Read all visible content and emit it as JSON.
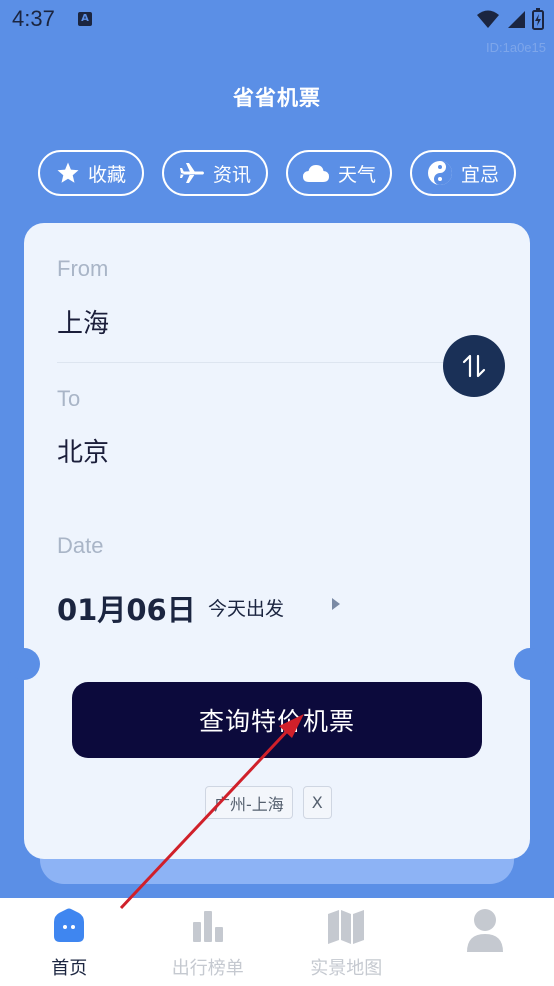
{
  "status_bar": {
    "time": "4:37",
    "notification_badge": "A"
  },
  "watermark": "ID:1a0e15",
  "app_title": "省省机票",
  "chips": [
    {
      "icon": "star-icon",
      "label": "收藏"
    },
    {
      "icon": "plane-icon",
      "label": "资讯"
    },
    {
      "icon": "cloud-icon",
      "label": "天气"
    },
    {
      "icon": "yin-yang-icon",
      "label": "宜忌"
    }
  ],
  "form": {
    "from_label": "From",
    "from_city": "上海",
    "to_label": "To",
    "to_city": "北京",
    "date_label": "Date",
    "date_value": "01月06日",
    "date_note": "今天出发"
  },
  "search_button": "查询特价机票",
  "history": {
    "item": "广州-上海",
    "clear": "X"
  },
  "tabs": [
    {
      "label": "首页",
      "icon": "home-icon",
      "active": true
    },
    {
      "label": "出行榜单",
      "icon": "bar-chart-icon",
      "active": false
    },
    {
      "label": "实景地图",
      "icon": "map-icon",
      "active": false
    },
    {
      "label": "",
      "icon": "user-icon",
      "active": false
    }
  ],
  "colors": {
    "background": "#5b8fe6",
    "card": "#eef4fd",
    "primary_dark": "#0c0a3c",
    "swap_button": "#1a3057",
    "annotation_arrow": "#d0202a"
  }
}
